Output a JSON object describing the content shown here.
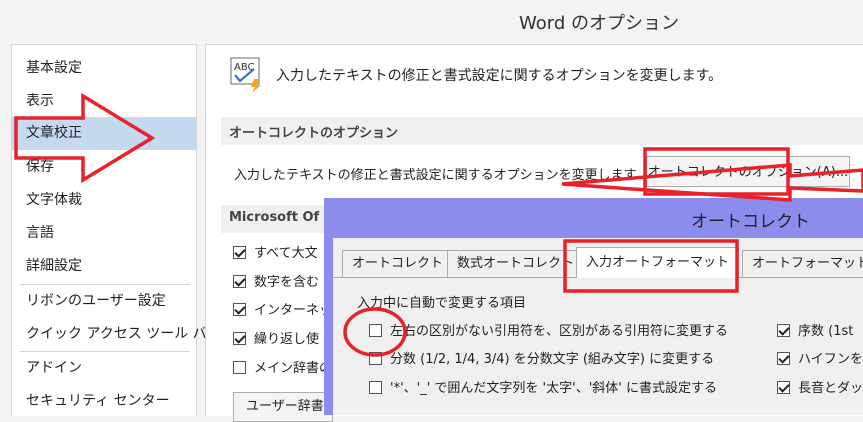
{
  "window": {
    "title": "Word のオプション"
  },
  "sidebar": {
    "items": [
      "基本設定",
      "表示",
      "文章校正",
      "保存",
      "文字体裁",
      "言語",
      "詳細設定",
      "リボンのユーザー設定",
      "クイック アクセス ツール バー",
      "アドイン",
      "セキュリティ センター"
    ],
    "selected": "文章校正"
  },
  "main": {
    "description": "入力したテキストの修正と書式設定に関するオプションを変更します。",
    "autocorrect_section": {
      "title": "オートコレクトのオプション",
      "description": "入力したテキストの修正と書式設定に関するオプションを変更します",
      "button": "オートコレクトのオプション(A)..."
    },
    "office_section": {
      "title": "Microsoft Of",
      "options": [
        {
          "label": "すべて大文",
          "checked": true
        },
        {
          "label": "数字を含む",
          "checked": true
        },
        {
          "label": "インターネッ",
          "checked": true
        },
        {
          "label": "繰り返し使",
          "checked": true
        },
        {
          "label": "メイン辞書の",
          "checked": false
        }
      ],
      "dictionary_button": "ユーザー辞書"
    }
  },
  "dialog": {
    "title": "オートコレクト",
    "tabs": [
      "オートコレクト",
      "数式オートコレクト",
      "入力オートフォーマット",
      "オートフォーマット"
    ],
    "active_tab": "入力オートフォーマット",
    "group_label": "入力中に自動で変更する項目",
    "left_options": [
      {
        "label": "左右の区別がない引用符を、区別がある引用符に変更する",
        "checked": false
      },
      {
        "label": "分数 (1/2, 1/4, 3/4) を分数文字 (組み文字) に変更する",
        "checked": false
      },
      {
        "label": "'*'、'_' で囲んだ文字列を '太字'、'斜体' に書式設定する",
        "checked": false
      }
    ],
    "right_options": [
      {
        "label": "序数 (1st",
        "checked": true
      },
      {
        "label": "ハイフンをダ",
        "checked": true
      },
      {
        "label": "長音とダッシ",
        "checked": true
      }
    ]
  },
  "colors": {
    "annotation_red": "#e8212b",
    "selection_blue": "#c5d9f1",
    "dialog_frame": "#8c8ced"
  }
}
